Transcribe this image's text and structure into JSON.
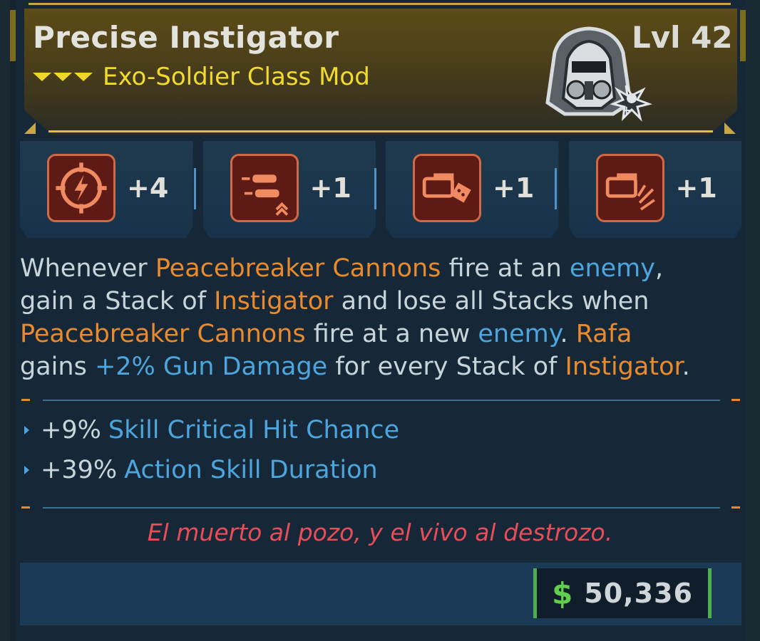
{
  "item": {
    "name": "Precise Instigator",
    "type": "Exo-Soldier Class Mod",
    "level": "Lvl 42",
    "rarity_icon": "chevron-rarity-icon",
    "portrait_icon": "exo-soldier-helmet-icon"
  },
  "perks": [
    {
      "icon": "lightning-crosshair-icon",
      "value": "+4"
    },
    {
      "icon": "bullets-upgrade-icon",
      "value": "+1"
    },
    {
      "icon": "cannon-dice-icon",
      "value": "+1"
    },
    {
      "icon": "cannon-spark-icon",
      "value": "+1"
    }
  ],
  "description": {
    "p1": "Whenever ",
    "p2": "Peacebreaker Cannons",
    "p3": " fire at an ",
    "p4": "enemy",
    "p5": ",",
    "p6": "gain a Stack of ",
    "p7": "Instigator",
    "p8": " and lose all Stacks when",
    "p9": "Peacebreaker Cannons",
    "p10": " fire at a new ",
    "p11": "enemy",
    "p12": ". ",
    "p13": "Rafa",
    "p14": "gains ",
    "p15": "+2% Gun Damage",
    "p16": " for every Stack of ",
    "p17": "Instigator",
    "p18": "."
  },
  "stats": [
    {
      "value": "+9%",
      "label": "Skill Critical Hit Chance"
    },
    {
      "value": "+39%",
      "label": "Action Skill Duration"
    }
  ],
  "flavor": "El muerto al pozo, y el vivo al destrozo.",
  "price": {
    "symbol": "$",
    "amount": "50,336"
  },
  "colors": {
    "accent_gold": "#f1dc2e",
    "orange": "#e98a2c",
    "blue": "#4ca5dc",
    "flavor_red": "#e84d58",
    "money_green": "#5fcf4d"
  }
}
